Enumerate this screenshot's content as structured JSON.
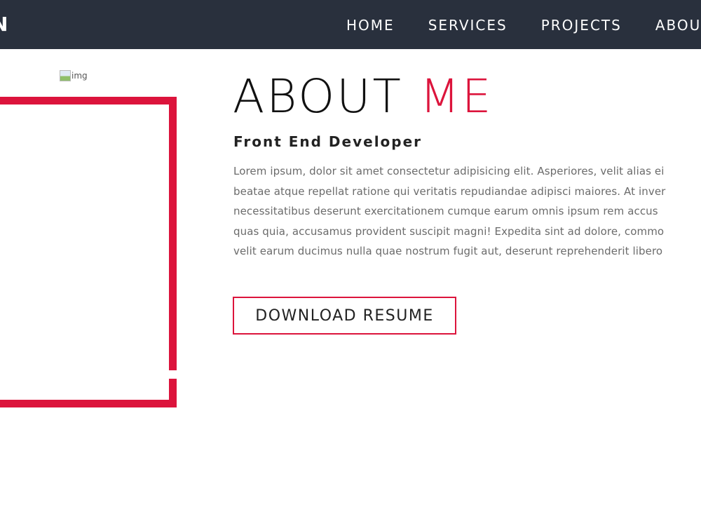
{
  "navbar": {
    "brand": "N",
    "links": [
      {
        "label": "HOME"
      },
      {
        "label": "SERVICES"
      },
      {
        "label": "PROJECTS"
      },
      {
        "label": "ABOUT"
      }
    ]
  },
  "about": {
    "image_alt": "img",
    "title_main": "ABOUT ",
    "title_accent": "ME",
    "role": "Front End Developer",
    "bio_lines": [
      "Lorem ipsum, dolor sit amet consectetur adipisicing elit. Asperiores, velit alias ei",
      "beatae atque repellat ratione qui veritatis repudiandae adipisci maiores. At inver",
      "necessitatibus deserunt exercitationem cumque earum omnis ipsum rem accus",
      "quas quia, accusamus provident suscipit magni! Expedita sint ad dolore, commo",
      "velit earum ducimus nulla quae nostrum fugit aut, deserunt reprehenderit libero"
    ],
    "button_label": "DOWNLOAD RESUME"
  },
  "colors": {
    "navbar_bg": "#29303d",
    "accent": "#dc143c",
    "text_dark": "#111111",
    "text_muted": "#6b6b6b"
  }
}
